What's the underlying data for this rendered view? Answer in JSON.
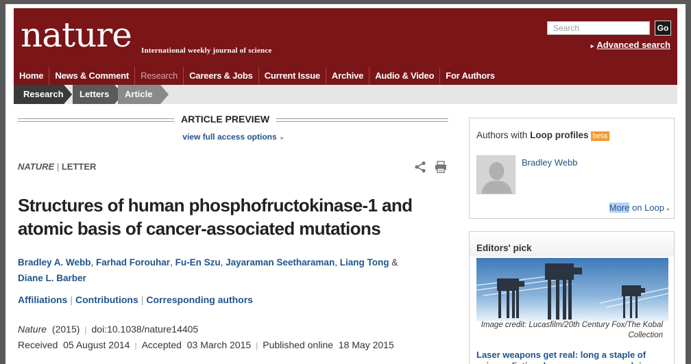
{
  "header": {
    "logo": "nature",
    "tagline": "International weekly journal of science",
    "search_placeholder": "Search",
    "go_label": "Go",
    "advanced_search": "Advanced search",
    "brand_color": "#7a1518"
  },
  "nav": {
    "items": [
      {
        "label": "Home"
      },
      {
        "label": "News & Comment"
      },
      {
        "label": "Research",
        "active": true
      },
      {
        "label": "Careers & Jobs"
      },
      {
        "label": "Current Issue"
      },
      {
        "label": "Archive"
      },
      {
        "label": "Audio & Video"
      },
      {
        "label": "For Authors"
      }
    ]
  },
  "breadcrumb": [
    "Research",
    "Letters",
    "Article"
  ],
  "article": {
    "preview_label": "ARTICLE PREVIEW",
    "full_access": "view full access options",
    "journal": "NATURE",
    "type": "LETTER",
    "title": "Structures of human phosphofructokinase-1 and atomic basis of cancer-associated mutations",
    "authors": [
      "Bradley A. Webb",
      "Farhad Forouhar",
      "Fu-En Szu",
      "Jayaraman Seetharaman",
      "Liang Tong",
      "Diane L. Barber"
    ],
    "author_last_sep": "&",
    "links": [
      "Affiliations",
      "Contributions",
      "Corresponding authors"
    ],
    "citation_journal": "Nature",
    "citation_year": "(2015)",
    "doi": "doi:10.1038/nature14405",
    "received": "Received  05 August 2014",
    "accepted": "Accepted  03 March 2015",
    "published": "Published online  18 May 2015"
  },
  "sidebar": {
    "loop_title_prefix": "Authors with",
    "loop_title_bold": "Loop profiles",
    "beta": "beta",
    "loop_author": "Bradley Webb",
    "more_highlight": "More",
    "more_rest": " on Loop",
    "editors_pick_title": "Editors' pick",
    "image_caption": "Image credit: Lucasfilm/20th Century Fox/The Kobal Collection",
    "pick_headline": "Laser weapons get real: long a staple of science fiction, laser weapons are edging"
  }
}
